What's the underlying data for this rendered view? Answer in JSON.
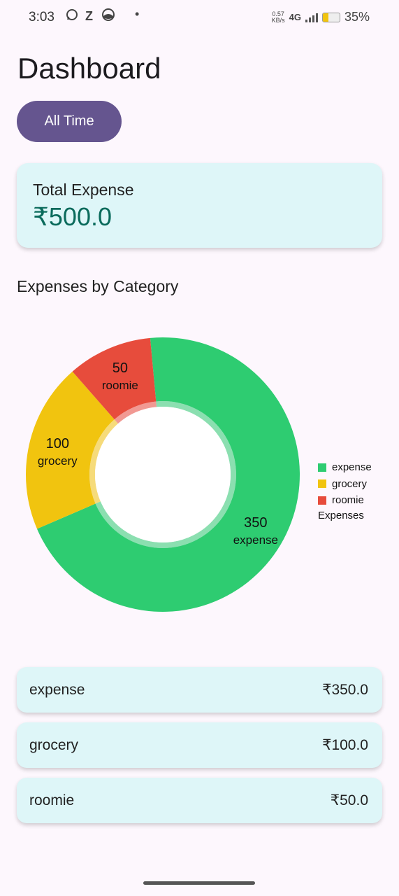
{
  "status_bar": {
    "time": "3:03",
    "notification_icons": [
      "whatsapp-icon",
      "z-app-icon",
      "app-icon",
      "dot"
    ],
    "net_speed_value": "0.57",
    "net_speed_unit": "KB/s",
    "network": "4G",
    "battery_level": 0.35,
    "battery_text": "35%"
  },
  "header": {
    "title": "Dashboard",
    "filter_label": "All Time"
  },
  "summary": {
    "label": "Total Expense",
    "value": "₹500.0"
  },
  "chart_section": {
    "title": "Expenses by Category"
  },
  "chart_data": {
    "type": "pie",
    "donut": true,
    "categories": [
      "expense",
      "grocery",
      "roomie"
    ],
    "values": [
      350,
      100,
      50
    ],
    "labels": [
      "350",
      "100",
      "50"
    ],
    "colors": [
      "#2ECC71",
      "#F1C40F",
      "#E74C3C"
    ],
    "legend_title": "Expenses",
    "legend_position": "right"
  },
  "categories": [
    {
      "name": "expense",
      "amount": "₹350.0"
    },
    {
      "name": "grocery",
      "amount": "₹100.0"
    },
    {
      "name": "roomie",
      "amount": "₹50.0"
    }
  ]
}
